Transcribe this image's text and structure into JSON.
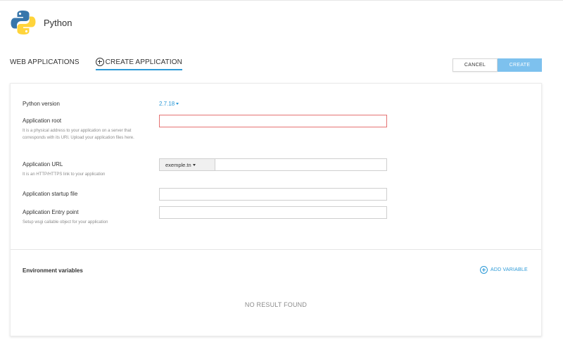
{
  "app": {
    "title": "Python",
    "logo_icon": "python-logo-icon"
  },
  "tabs": [
    {
      "label": "WEB APPLICATIONS",
      "active": false
    },
    {
      "label": "CREATE APPLICATION",
      "active": true,
      "icon": "plus-circle-icon"
    }
  ],
  "actions": {
    "cancel_label": "CANCEL",
    "create_label": "CREATE"
  },
  "form": {
    "python_version": {
      "label": "Python version",
      "value": "2.7.18"
    },
    "app_root": {
      "label": "Application root",
      "hint": "It is a physical address to your application on a server that corresponds with its URI. Upload your application files here.",
      "value": "",
      "state": "error"
    },
    "app_url": {
      "label": "Application URL",
      "hint": "It is an HTTP/HTTPS link to your application",
      "domain": "exemple.tn",
      "value": ""
    },
    "startup_file": {
      "label": "Application startup file",
      "value": ""
    },
    "entry_point": {
      "label": "Application Entry point",
      "hint": "Setup wsgi callable object for your application",
      "value": ""
    }
  },
  "env": {
    "title": "Environment variables",
    "add_label": "ADD VARIABLE",
    "empty_text": "NO RESULT FOUND"
  },
  "colors": {
    "accent": "#2d9ad7",
    "create_button_disabled": "#7dc1ee",
    "error_border": "#e57373",
    "python_blue": "#3776ab",
    "python_yellow": "#ffd43b"
  }
}
